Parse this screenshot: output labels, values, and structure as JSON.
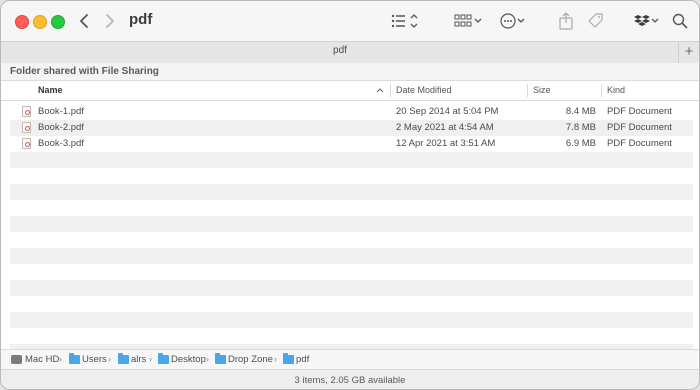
{
  "window": {
    "title": "pdf",
    "tab_title": "pdf",
    "tab_plus": "+",
    "banner": "Folder shared with File Sharing"
  },
  "toolbar": {
    "icons": [
      "back-chevron-icon",
      "forward-chevron-icon",
      "list-view-icon",
      "gallery-view-icon",
      "more-actions-icon",
      "share-icon",
      "tag-icon",
      "dropbox-icon",
      "search-icon"
    ]
  },
  "columns": {
    "name": "Name",
    "date": "Date Modified",
    "size": "Size",
    "kind": "Kind"
  },
  "files": [
    {
      "name": "Book-1.pdf",
      "date": "20 Sep 2014 at 5:04 PM",
      "size": "8.4 MB",
      "kind": "PDF Document"
    },
    {
      "name": "Book-2.pdf",
      "date": "2 May 2021 at 4:54 AM",
      "size": "7.8 MB",
      "kind": "PDF Document"
    },
    {
      "name": "Book-3.pdf",
      "date": "12 Apr 2021 at 3:51 AM",
      "size": "6.9 MB",
      "kind": "PDF Document"
    }
  ],
  "pathbar": {
    "crumbs": [
      "Mac HD",
      "Users",
      "alrs",
      "Desktop",
      "Drop Zone",
      "pdf"
    ]
  },
  "status": {
    "text": "3 items, 2.05 GB available"
  },
  "colors": {
    "close": "#ff5f57",
    "minimize": "#febc2e",
    "maximize": "#28c840",
    "folder": "#4ba6e8"
  }
}
